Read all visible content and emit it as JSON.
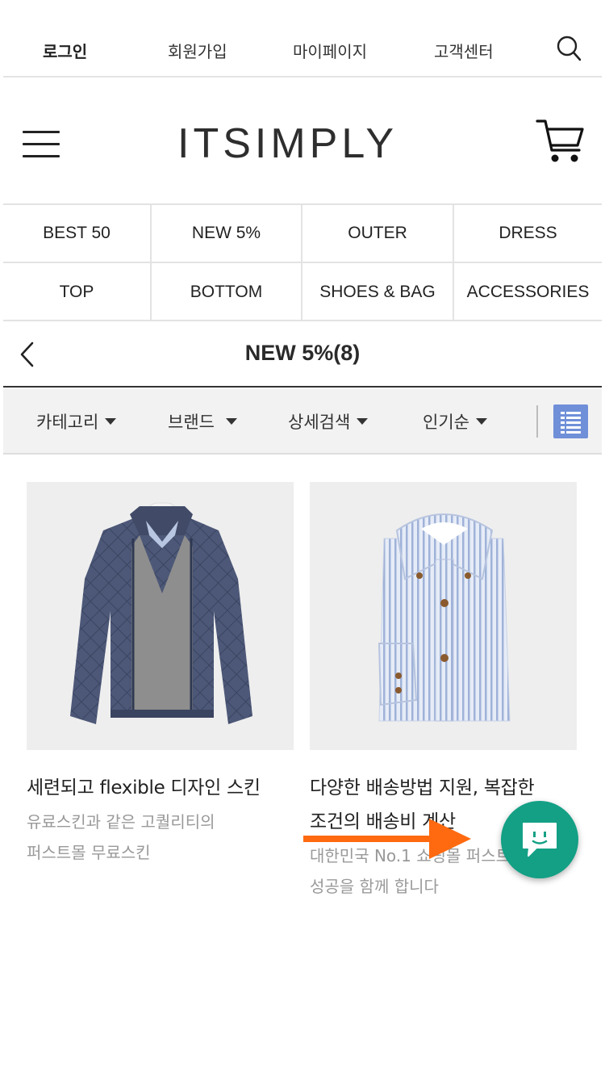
{
  "topbar": {
    "links": [
      {
        "id": "login",
        "label": "로그인"
      },
      {
        "id": "signup",
        "label": "회원가입"
      },
      {
        "id": "mypage",
        "label": "마이페이지"
      },
      {
        "id": "support",
        "label": "고객센터"
      }
    ],
    "search_icon": "search-icon"
  },
  "header": {
    "logo": "ITSIMPLY",
    "menu_icon": "hamburger-menu-icon",
    "cart_icon": "shopping-cart-icon"
  },
  "categories": [
    "BEST 50",
    "NEW 5%",
    "OUTER",
    "DRESS",
    "TOP",
    "BOTTOM",
    "SHOES & BAG",
    "ACCESSORIES"
  ],
  "page": {
    "title": "NEW 5%(8)",
    "back_icon": "chevron-left-icon"
  },
  "filters": [
    {
      "label": "카테고리"
    },
    {
      "label": "브랜드"
    },
    {
      "label": "상세검색"
    },
    {
      "label": "인기순"
    }
  ],
  "view_toggle": {
    "icon": "list-view-icon",
    "color": "#6f8fd8"
  },
  "products": [
    {
      "name": "세련되고 flexible 디자인 스킨",
      "desc_lines": [
        "유료스킨과 같은 고퀄리티의",
        "퍼스트몰 무료스킨"
      ],
      "image_icon": "quilted-jacket-image"
    },
    {
      "name_lines": [
        "다양한 배송방법 지원, 복잡한",
        "조건의 배송비 계산"
      ],
      "desc_lines": [
        "대한민국 No.1 쇼핑몰 퍼스트몰",
        "성공을 함께 합니다"
      ],
      "image_icon": "striped-shirt-image"
    }
  ],
  "overlay": {
    "arrow_color": "#ff6a10",
    "chat_color": "#13a085",
    "chat_icon": "chat-bubble-icon"
  }
}
